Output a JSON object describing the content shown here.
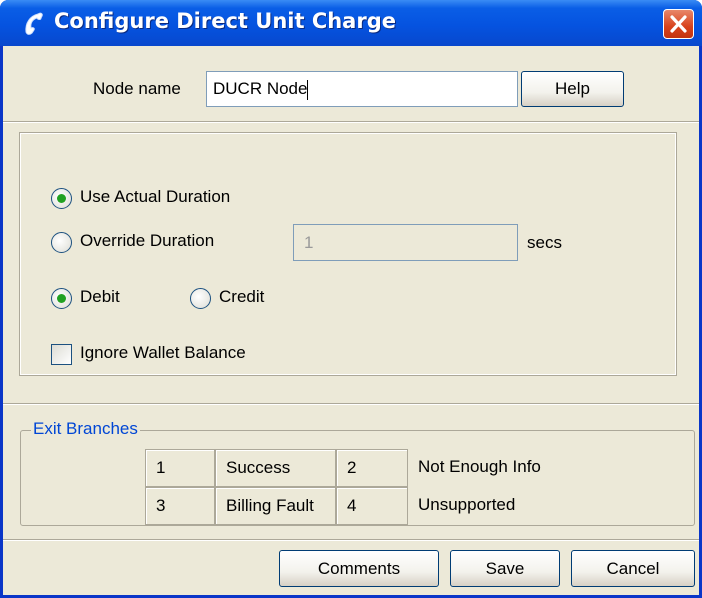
{
  "window": {
    "title": "Configure Direct Unit Charge",
    "colors": {
      "titlebar": "#0553e0",
      "client": "#ece9d8",
      "close": "#d8421c",
      "radio_dot": "#21a121",
      "group_label": "#0046d5"
    }
  },
  "node_name": {
    "label": "Node name",
    "value": "DUCR Node"
  },
  "help_button": "Help",
  "options": {
    "use_actual_duration": {
      "label": "Use Actual Duration",
      "selected": true
    },
    "override_duration": {
      "label": "Override Duration",
      "selected": false,
      "value": "1",
      "unit": "secs"
    },
    "debit": {
      "label": "Debit",
      "selected": true
    },
    "credit": {
      "label": "Credit",
      "selected": false
    },
    "ignore_wallet_balance": {
      "label": "Ignore Wallet Balance",
      "checked": false
    }
  },
  "exit_branches": {
    "title": "Exit Branches",
    "rows": [
      [
        {
          "num": "1",
          "label": "Success"
        },
        {
          "num": "2",
          "label": "Not Enough Info"
        }
      ],
      [
        {
          "num": "3",
          "label": "Billing Fault"
        },
        {
          "num": "4",
          "label": "Unsupported"
        }
      ]
    ]
  },
  "buttons": {
    "comments": "Comments",
    "save": "Save",
    "cancel": "Cancel"
  },
  "icons": {
    "title": "phone-icon",
    "close": "close-icon"
  }
}
